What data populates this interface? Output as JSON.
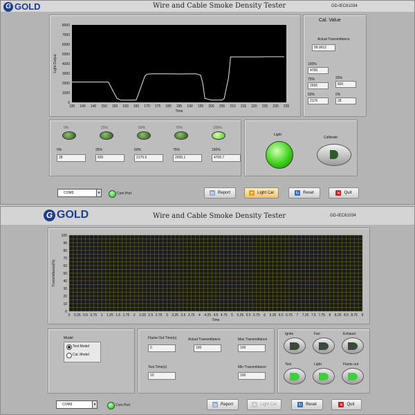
{
  "brand": "GOLD",
  "top": {
    "title": "Wire and Cable Smoke Density Tester",
    "model": "GD-IEC61034",
    "chart": {
      "type": "line",
      "xlabel": "Time",
      "ylabel": "Light Output",
      "x_ticks": [
        "135",
        "140",
        "145",
        "150",
        "155",
        "160",
        "165",
        "170",
        "175",
        "180",
        "185",
        "190",
        "195",
        "200",
        "205",
        "210",
        "215",
        "220",
        "225",
        "230",
        "235"
      ],
      "y_ticks": [
        "0",
        "1000",
        "2000",
        "3000",
        "4000",
        "5000",
        "6000",
        "7000",
        "8000"
      ]
    },
    "cal": {
      "header": "Cal. Value",
      "actual_label": "Actual Transmittance",
      "actual_value": "99.9012",
      "p100_label": "100%",
      "p100_value": "4706",
      "p75_label": "75%",
      "p75_value": "2935",
      "p25_label": "25%",
      "p25_value": "820",
      "p50_label": "50%",
      "p50_value": "2176",
      "p0_label": "0%",
      "p0_value": "28"
    },
    "leds": [
      {
        "label": "0%",
        "on": false
      },
      {
        "label": "25%",
        "on": false
      },
      {
        "label": "50%",
        "on": false
      },
      {
        "label": "75%",
        "on": false
      },
      {
        "label": "100%",
        "on": true
      }
    ],
    "readings": [
      {
        "label": "0%",
        "value": "28"
      },
      {
        "label": "25%",
        "value": "820"
      },
      {
        "label": "50%",
        "value": "2175.5"
      },
      {
        "label": "75%",
        "value": "2935.1"
      },
      {
        "label": "100%",
        "value": "4705.7"
      }
    ],
    "light_label": "Light",
    "calibrate_label": "Calibrate",
    "footer": {
      "com_value": "COM3",
      "com_port": "Com Port",
      "report": "Report",
      "light_cal": "Light Cal",
      "reset": "Reset",
      "quit": "Quit"
    }
  },
  "bottom": {
    "title": "Wire and Cable Smoke Density Tester",
    "model": "GD-IEC61034",
    "chart": {
      "type": "line",
      "xlabel": "Time",
      "ylabel": "Transmittance(%)",
      "x_ticks": [
        "0",
        "0.25",
        "0.5",
        "0.75",
        "1",
        "1.25",
        "1.5",
        "1.75",
        "2",
        "2.25",
        "2.5",
        "2.75",
        "3",
        "3.25",
        "3.5",
        "3.75",
        "4",
        "4.25",
        "4.5",
        "4.75",
        "5",
        "5.25",
        "5.5",
        "5.75",
        "6",
        "6.25",
        "6.5",
        "6.75",
        "7",
        "7.25",
        "7.5",
        "7.75",
        "8",
        "8.25",
        "8.5",
        "8.75",
        "9"
      ],
      "y_ticks": [
        "0",
        "10",
        "20",
        "30",
        "40",
        "50",
        "60",
        "70",
        "80",
        "90",
        "100"
      ]
    },
    "model_group": {
      "label": "Model",
      "test_model": "Test Model",
      "cal_model": "Cal. Model"
    },
    "fields": {
      "flame_out_label": "Flame Out Time(s)",
      "flame_out_value": "0",
      "actual_label": "Actual Transmittance",
      "actual_value": "100",
      "max_label": "Max Transmittance",
      "max_value": "100",
      "test_time_label": "Test Time(s)",
      "test_time_value": "10",
      "min_label": "Min Transmittance",
      "min_value": "100"
    },
    "controls": [
      {
        "label": "Ignite",
        "on": false
      },
      {
        "label": "Fan",
        "on": false
      },
      {
        "label": "Exhaust",
        "on": false
      },
      {
        "label": "Test",
        "on": true
      },
      {
        "label": "Light",
        "on": true
      },
      {
        "label": "Flame out",
        "on": true
      }
    ],
    "footer": {
      "com_value": "COM3",
      "com_port": "Com Port",
      "report": "Report",
      "light_cal": "Light Cal",
      "reset": "Reset",
      "quit": "Quit"
    }
  },
  "chart_data": [
    {
      "type": "line",
      "title": "",
      "xlabel": "Time",
      "ylabel": "Light Output",
      "xlim": [
        135,
        235
      ],
      "ylim": [
        0,
        8000
      ],
      "grid": false,
      "series": [
        {
          "x": [
            135,
            152,
            156,
            158,
            163,
            165,
            169,
            170,
            172,
            180,
            185,
            190,
            193,
            195,
            196,
            197,
            200,
            202,
            205,
            206,
            208,
            209,
            215,
            220,
            225,
            230,
            234
          ],
          "y": [
            2100,
            2100,
            400,
            230,
            230,
            250,
            2700,
            2900,
            2950,
            2950,
            2930,
            2950,
            2950,
            2800,
            2000,
            400,
            240,
            240,
            240,
            400,
            2500,
            4700,
            4700,
            4700,
            4710,
            4710,
            4710
          ]
        }
      ]
    },
    {
      "type": "line",
      "title": "",
      "xlabel": "Time",
      "ylabel": "Transmittance(%)",
      "xlim": [
        0,
        9
      ],
      "ylim": [
        0,
        100
      ],
      "grid": true,
      "series": []
    }
  ]
}
